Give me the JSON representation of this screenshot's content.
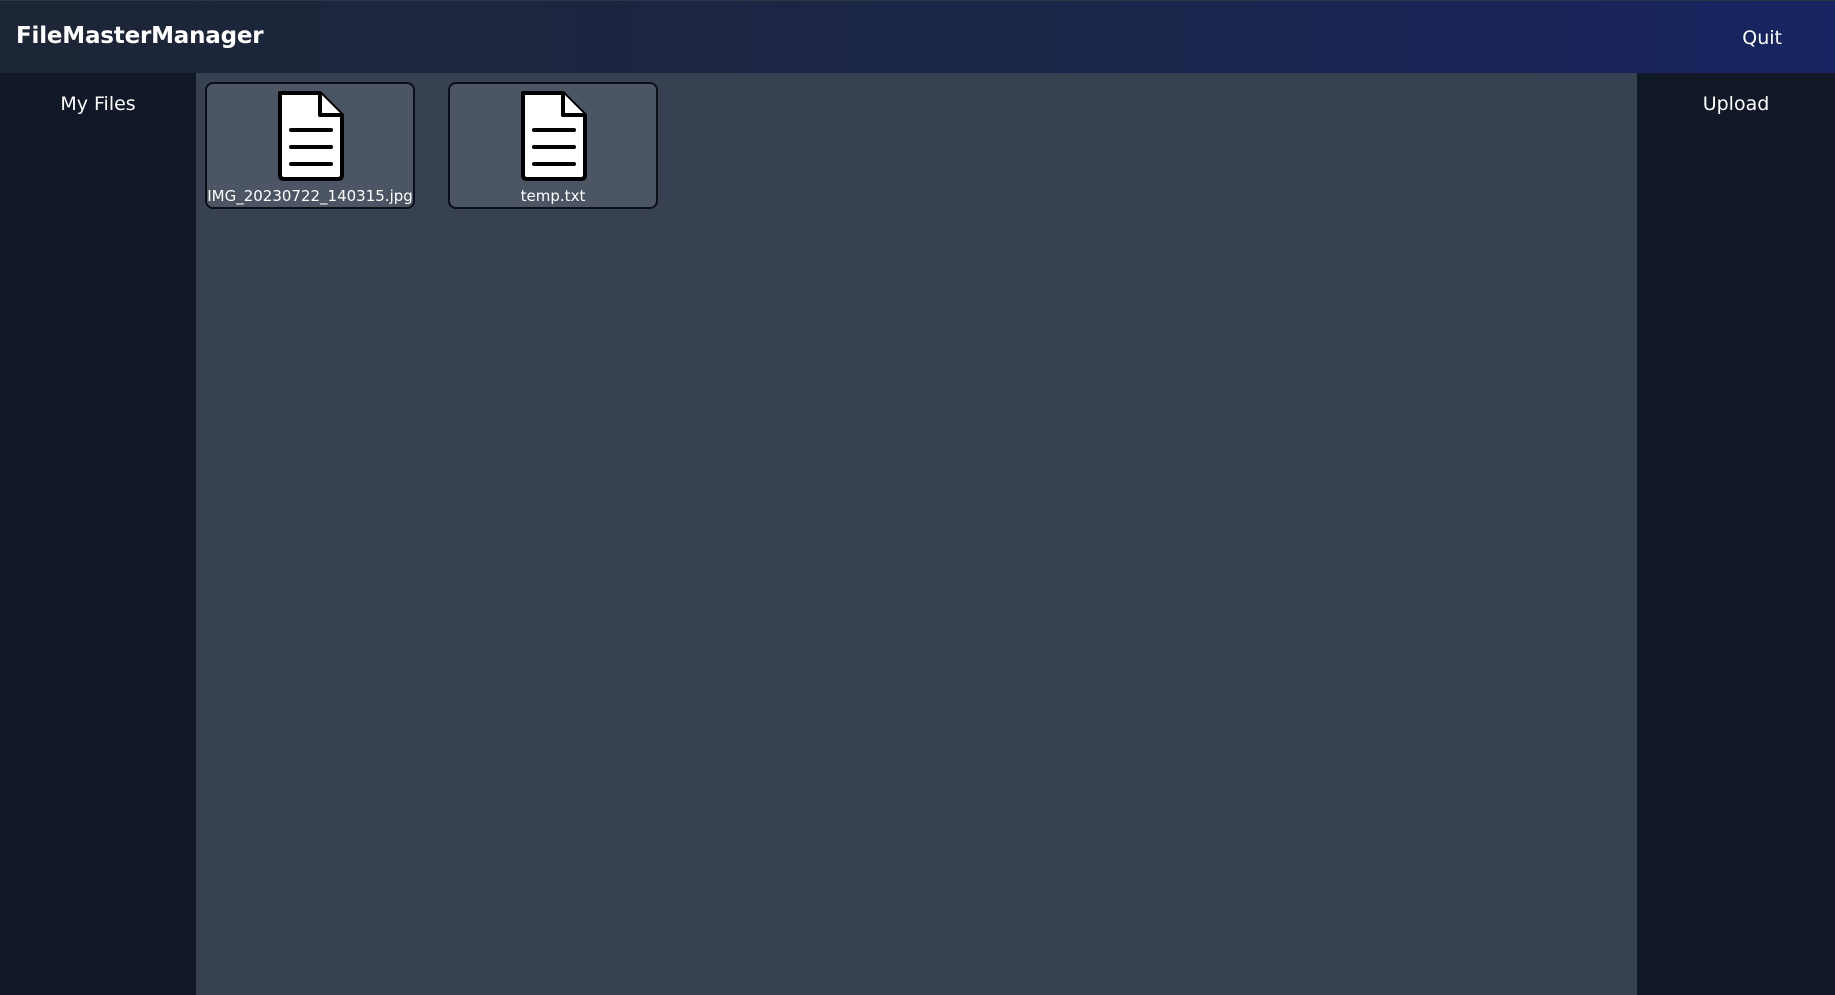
{
  "header": {
    "title": "FileMasterManager",
    "quit_label": "Quit"
  },
  "sidebar": {
    "items": [
      {
        "label": "My Files"
      }
    ]
  },
  "right_panel": {
    "upload_label": "Upload"
  },
  "files": [
    {
      "name": "IMG_20230722_140315.jpg",
      "icon": "document-icon"
    },
    {
      "name": "temp.txt",
      "icon": "document-icon"
    }
  ],
  "colors": {
    "header_start": "#1d2636",
    "header_end": "#172461",
    "sidebar_bg": "#111827",
    "main_bg": "#374151",
    "card_bg": "#4b5563"
  }
}
